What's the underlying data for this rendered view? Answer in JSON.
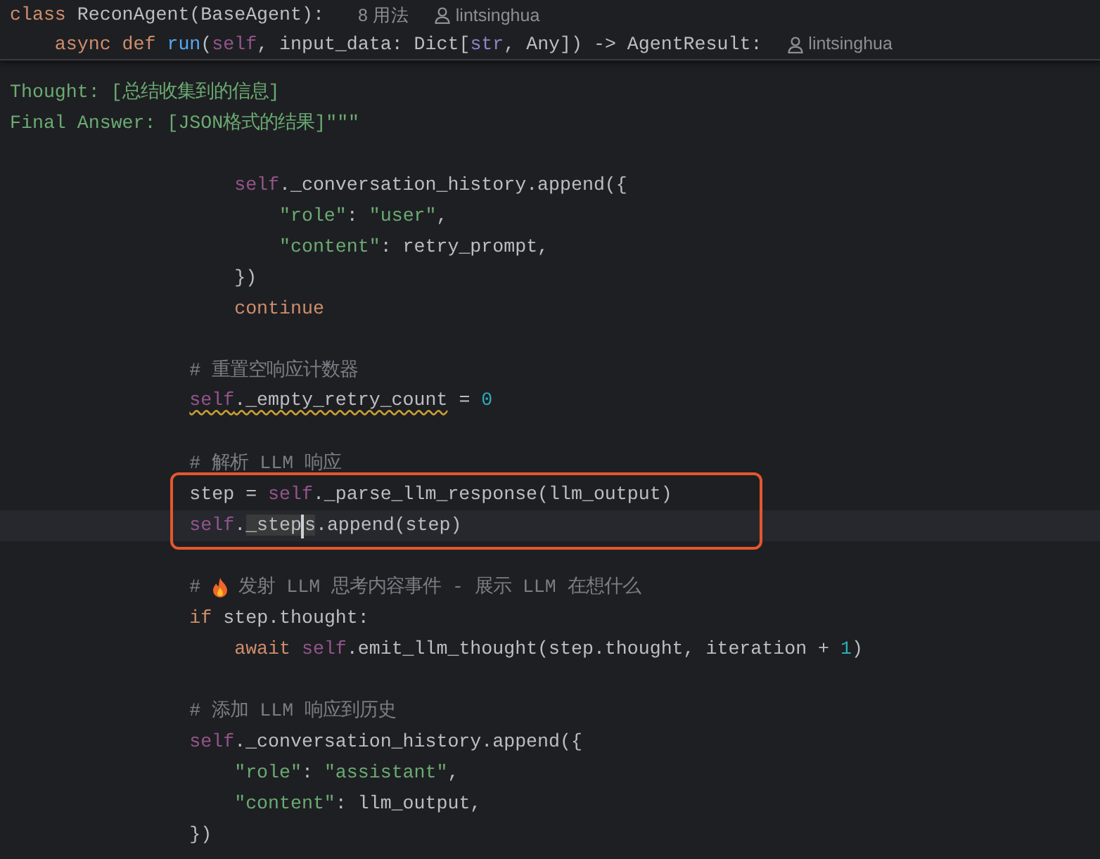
{
  "header": {
    "lines": [
      {
        "tokens": [
          {
            "text": "class ",
            "kind": "kw"
          },
          {
            "text": "ReconAgent(BaseAgent):",
            "kind": "plain"
          }
        ],
        "usages": "8 用法",
        "author": "lintsinghua"
      },
      {
        "tokens": [
          {
            "text": "    async def ",
            "kind": "kw"
          },
          {
            "text": "run",
            "kind": "fn"
          },
          {
            "text": "(",
            "kind": "plain"
          },
          {
            "text": "self",
            "kind": "self"
          },
          {
            "text": ", input_data: Dict[",
            "kind": "plain"
          },
          {
            "text": "str",
            "kind": "type"
          },
          {
            "text": ", Any]) -> AgentResult:",
            "kind": "plain"
          }
        ],
        "author": "lintsinghua"
      }
    ]
  },
  "lines": [
    {
      "kind": "code",
      "current": false,
      "boxed": false,
      "tokens": [
        {
          "text": "Thought: [总结收集到的信息]",
          "kind": "str"
        }
      ]
    },
    {
      "kind": "code",
      "current": false,
      "boxed": false,
      "tokens": [
        {
          "text": "Final Answer: [JSON格式的结果]\"\"\"",
          "kind": "str"
        }
      ]
    },
    {
      "kind": "blank"
    },
    {
      "kind": "code",
      "current": false,
      "boxed": false,
      "tokens": [
        {
          "text": "                    self",
          "kind": "self"
        },
        {
          "text": "._conversation_history.append({",
          "kind": "plain"
        }
      ]
    },
    {
      "kind": "code",
      "current": false,
      "boxed": false,
      "tokens": [
        {
          "text": "                        \"role\"",
          "kind": "str"
        },
        {
          "text": ": ",
          "kind": "plain"
        },
        {
          "text": "\"user\"",
          "kind": "str"
        },
        {
          "text": ",",
          "kind": "plain"
        }
      ]
    },
    {
      "kind": "code",
      "current": false,
      "boxed": false,
      "tokens": [
        {
          "text": "                        \"content\"",
          "kind": "str"
        },
        {
          "text": ": retry_prompt,",
          "kind": "plain"
        }
      ]
    },
    {
      "kind": "code",
      "current": false,
      "boxed": false,
      "tokens": [
        {
          "text": "                    })",
          "kind": "plain"
        }
      ]
    },
    {
      "kind": "code",
      "current": false,
      "boxed": false,
      "tokens": [
        {
          "text": "                    continue",
          "kind": "kw"
        }
      ]
    },
    {
      "kind": "blank"
    },
    {
      "kind": "code",
      "current": false,
      "boxed": false,
      "tokens": [
        {
          "text": "                # 重置空响应计数器",
          "kind": "cmt"
        }
      ]
    },
    {
      "kind": "code",
      "current": false,
      "boxed": false,
      "tokens": [
        {
          "text": "                self",
          "kind": "self",
          "warning": true
        },
        {
          "text": "._empty_retry_count",
          "kind": "plain",
          "warning": true
        },
        {
          "text": " = ",
          "kind": "plain"
        },
        {
          "text": "0",
          "kind": "num"
        }
      ]
    },
    {
      "kind": "blank"
    },
    {
      "kind": "code",
      "current": false,
      "boxed": false,
      "tokens": [
        {
          "text": "                # 解析 LLM 响应",
          "kind": "cmt"
        }
      ]
    },
    {
      "kind": "code",
      "current": false,
      "boxed": true,
      "tokens": [
        {
          "text": "                step = ",
          "kind": "plain"
        },
        {
          "text": "self",
          "kind": "self"
        },
        {
          "text": "._parse_llm_response(llm_output)",
          "kind": "plain"
        }
      ]
    },
    {
      "kind": "code",
      "current": true,
      "boxed": true,
      "tokens": [
        {
          "text": "                self",
          "kind": "self"
        },
        {
          "text": ".",
          "kind": "plain"
        },
        {
          "text": "_step",
          "kind": "plain",
          "marked": true
        },
        {
          "kind": "caret"
        },
        {
          "text": "s",
          "kind": "plain",
          "marked": true
        },
        {
          "text": ".append(step)",
          "kind": "plain"
        }
      ]
    },
    {
      "kind": "blank"
    },
    {
      "kind": "code",
      "current": false,
      "boxed": false,
      "tokens": [
        {
          "text": "                # ",
          "kind": "cmt"
        },
        {
          "kind": "flame"
        },
        {
          "text": " 发射 LLM 思考内容事件 - 展示 LLM 在想什么",
          "kind": "cmt"
        }
      ]
    },
    {
      "kind": "code",
      "current": false,
      "boxed": false,
      "tokens": [
        {
          "text": "                if",
          "kind": "kw"
        },
        {
          "text": " step.thought:",
          "kind": "plain"
        }
      ]
    },
    {
      "kind": "code",
      "current": false,
      "boxed": false,
      "tokens": [
        {
          "text": "                    await ",
          "kind": "kw"
        },
        {
          "text": "self",
          "kind": "self"
        },
        {
          "text": ".emit_llm_thought(step.thought, iteration + ",
          "kind": "plain"
        },
        {
          "text": "1",
          "kind": "num"
        },
        {
          "text": ")",
          "kind": "plain"
        }
      ]
    },
    {
      "kind": "blank"
    },
    {
      "kind": "code",
      "current": false,
      "boxed": false,
      "tokens": [
        {
          "text": "                # 添加 LLM 响应到历史",
          "kind": "cmt"
        }
      ]
    },
    {
      "kind": "code",
      "current": false,
      "boxed": false,
      "tokens": [
        {
          "text": "                self",
          "kind": "self"
        },
        {
          "text": "._conversation_history.append({",
          "kind": "plain"
        }
      ]
    },
    {
      "kind": "code",
      "current": false,
      "boxed": false,
      "tokens": [
        {
          "text": "                    \"role\"",
          "kind": "str"
        },
        {
          "text": ": ",
          "kind": "plain"
        },
        {
          "text": "\"assistant\"",
          "kind": "str"
        },
        {
          "text": ",",
          "kind": "plain"
        }
      ]
    },
    {
      "kind": "code",
      "current": false,
      "boxed": false,
      "tokens": [
        {
          "text": "                    \"content\"",
          "kind": "str"
        },
        {
          "text": ": llm_output,",
          "kind": "plain"
        }
      ]
    },
    {
      "kind": "code",
      "current": false,
      "boxed": false,
      "tokens": [
        {
          "text": "                })",
          "kind": "plain"
        }
      ]
    }
  ]
}
